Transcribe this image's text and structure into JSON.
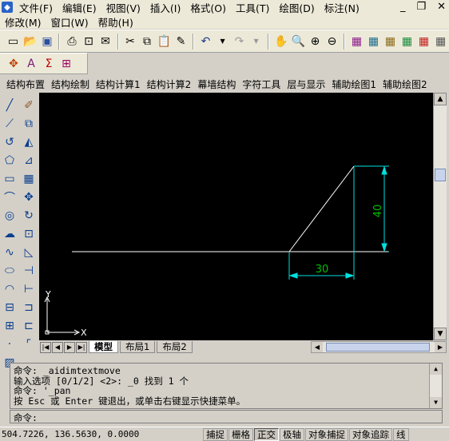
{
  "menubar": {
    "row1": [
      "文件(F)",
      "编辑(E)",
      "视图(V)",
      "插入(I)",
      "格式(O)",
      "工具(T)",
      "绘图(D)",
      "标注(N)"
    ],
    "row2": [
      "修改(M)",
      "窗口(W)",
      "帮助(H)"
    ]
  },
  "window_buttons": {
    "minimize": "_",
    "restore": "❐",
    "close": "✕"
  },
  "structure_menu": [
    "结构布置",
    "结构绘制",
    "结构计算1",
    "结构计算2",
    "幕墙结构",
    "字符工具",
    "层与显示",
    "辅助绘图1",
    "辅助绘图2"
  ],
  "drawing": {
    "dim_horizontal": "30",
    "dim_vertical": "40",
    "ucs_x": "X",
    "ucs_y": "Y",
    "colors": {
      "background": "#000000",
      "geometry": "#ffffff",
      "dimension": "#00e0e0",
      "dim_text": "#00c000"
    }
  },
  "layout_tabs": [
    "模型",
    "布局1",
    "布局2"
  ],
  "command": {
    "history": [
      "命令: _aidimtextmove",
      "输入选项 [0/1/2] <2>: _0 找到 1 个",
      "命令: '_pan",
      "按 Esc 或 Enter 键退出，或单击右键显示快捷菜单。"
    ],
    "prompt": "命令:"
  },
  "status": {
    "coords": "504.7226,  136.5630,  0.0000",
    "toggles": [
      {
        "label": "捕捉",
        "on": false
      },
      {
        "label": "栅格",
        "on": false
      },
      {
        "label": "正交",
        "on": true
      },
      {
        "label": "极轴",
        "on": false
      },
      {
        "label": "对象捕捉",
        "on": false
      },
      {
        "label": "对象追踪",
        "on": false
      },
      {
        "label": "线",
        "on": false
      }
    ]
  }
}
